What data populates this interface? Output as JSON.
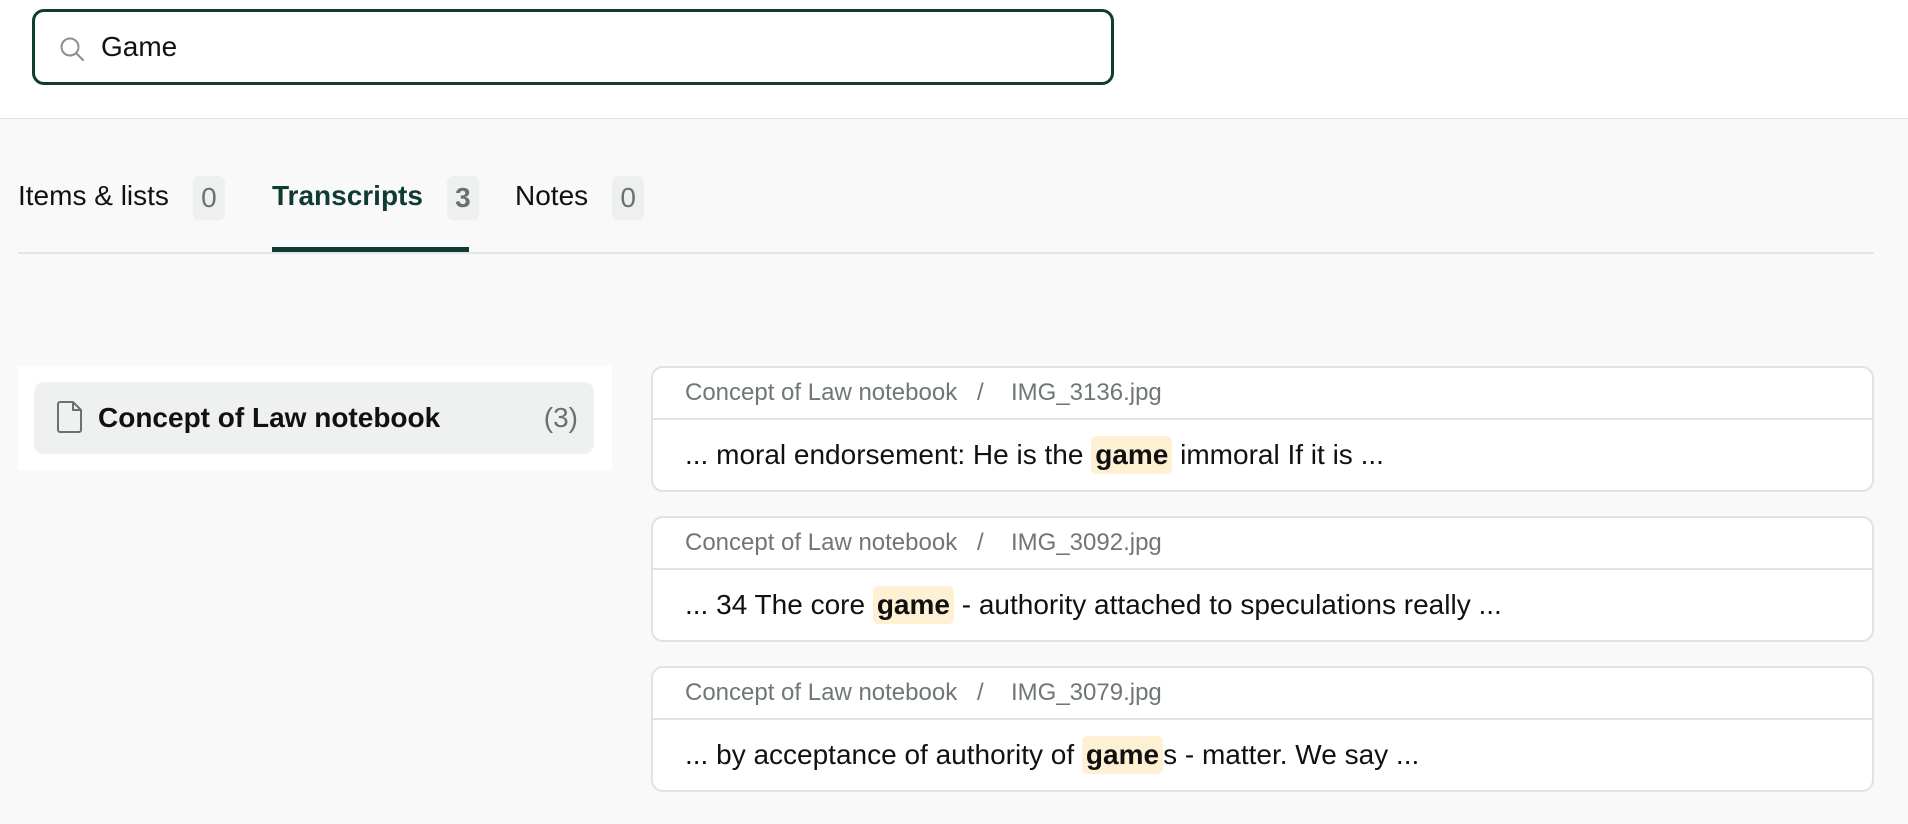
{
  "search": {
    "value": "Game",
    "icon": "search-icon"
  },
  "tabs": [
    {
      "label": "Items & lists",
      "count": "0",
      "active": false
    },
    {
      "label": "Transcripts",
      "count": "3",
      "active": true
    },
    {
      "label": "Notes",
      "count": "0",
      "active": false
    }
  ],
  "sidebar": {
    "document": {
      "icon": "document-icon",
      "title": "Concept of Law notebook",
      "count": "(3)"
    }
  },
  "results": [
    {
      "notebook": "Concept of Law notebook",
      "separator": "/",
      "file": "IMG_3136.jpg",
      "before": "... moral endorsement: He is the ",
      "match": "game",
      "after": " immoral If it is ..."
    },
    {
      "notebook": "Concept of Law notebook",
      "separator": "/",
      "file": "IMG_3092.jpg",
      "before": "... 34 The core ",
      "match": "game",
      "after": " - authority attached to speculations really ..."
    },
    {
      "notebook": "Concept of Law notebook",
      "separator": "/",
      "file": "IMG_3079.jpg",
      "before": "... by acceptance of authority of ",
      "match": "game",
      "after": "s - matter. We say ..."
    }
  ],
  "colors": {
    "accent": "#0f3b33",
    "highlight": "#fdf0d3",
    "muted": "#6b716f"
  }
}
